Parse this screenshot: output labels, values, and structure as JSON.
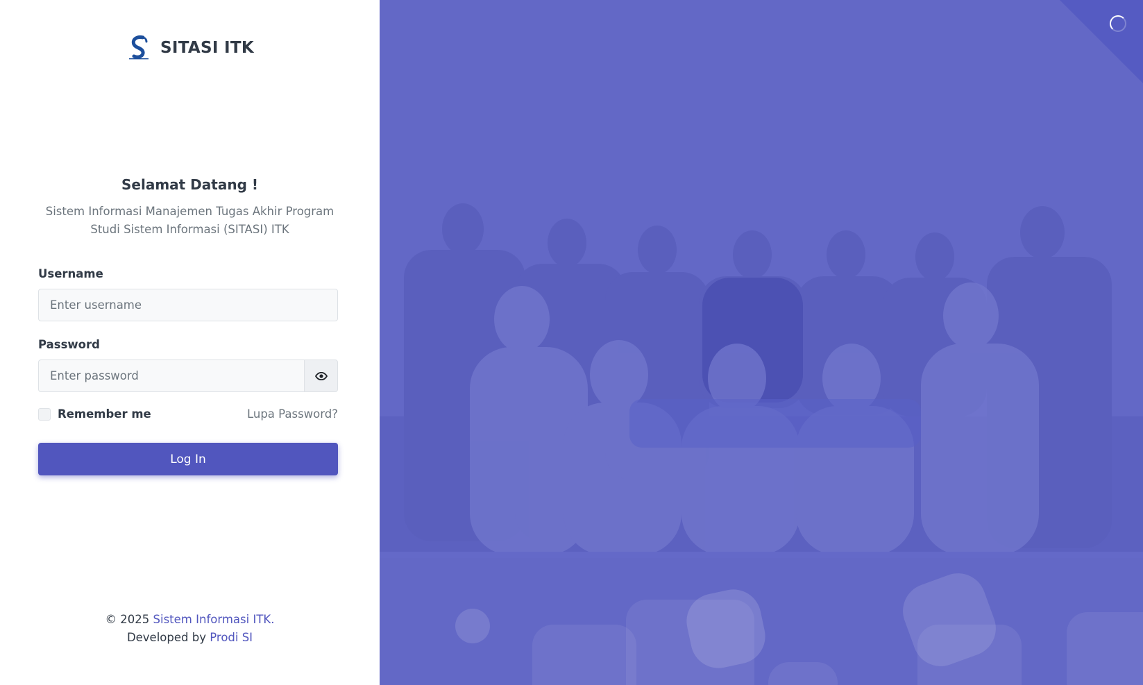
{
  "brand": {
    "name": "SITASI ITK",
    "logo_icon": "sitasi-logo-icon"
  },
  "welcome": {
    "title": "Selamat Datang !",
    "subtitle": "Sistem Informasi Manajemen Tugas Akhir Program Studi Sistem Informasi (SITASI) ITK"
  },
  "form": {
    "username_label": "Username",
    "username_placeholder": "Enter username",
    "username_value": "",
    "password_label": "Password",
    "password_placeholder": "Enter password",
    "password_value": "",
    "show_password_icon": "eye-icon",
    "remember_label": "Remember me",
    "remember_checked": false,
    "forgot_label": "Lupa Password?",
    "login_label": "Log In"
  },
  "footer": {
    "copyright_prefix": "© 2025",
    "copyright_link": "Sistem Informasi ITK.",
    "developed_prefix": "Developed by",
    "developed_link": "Prodi SI"
  },
  "colors": {
    "accent": "#5156be",
    "panel_overlay": "#6368c6",
    "text_dark": "#313a46",
    "text_muted": "#6c757d"
  },
  "right_panel": {
    "loading_icon": "spinner-icon",
    "photo": "group-photo"
  }
}
